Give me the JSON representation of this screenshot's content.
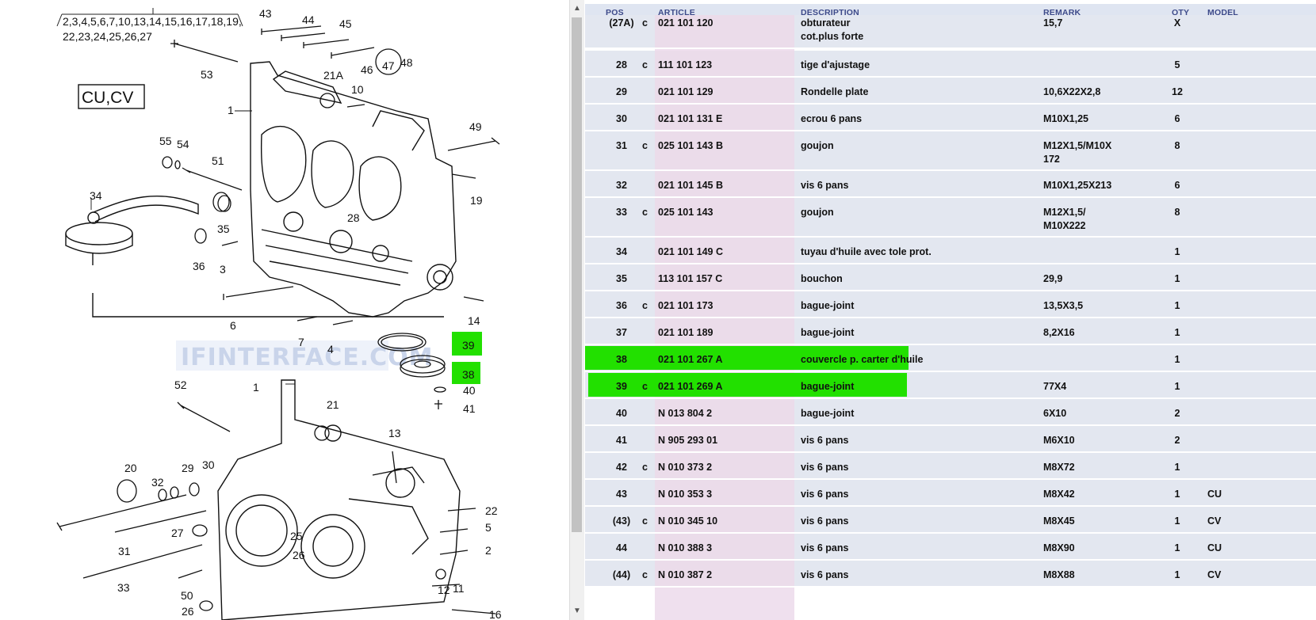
{
  "diagram": {
    "top_list_line1": "2,3,4,5,6,7,10,13,14,15,16,17,18,19,",
    "top_list_line2": "22,23,24,25,26,27",
    "variant_box": "CU,CV",
    "watermark": "IFINTERFACE.COM",
    "callouts": {
      "c43": "43",
      "c44": "44",
      "c45": "45",
      "c46": "46",
      "c47": "47",
      "c48": "48",
      "c53": "53",
      "c21A": "21A",
      "c10": "10",
      "c1a": "1",
      "c49": "49",
      "c55": "55",
      "c54": "54",
      "c51": "51",
      "c34": "34",
      "c19": "19",
      "c35": "35",
      "c28": "28",
      "c36": "36",
      "c3a": "3",
      "c6": "6",
      "c7": "7",
      "c4": "4",
      "c14": "14",
      "c39": "39",
      "c38": "38",
      "c40": "40",
      "c41": "41",
      "c52": "52",
      "c1b": "1",
      "c21": "21",
      "c13": "13",
      "c20": "20",
      "c29": "29",
      "c30": "30",
      "c32": "32",
      "c22": "22",
      "c5": "5",
      "c27": "27",
      "c25": "25",
      "c31": "31",
      "c26a": "26",
      "c2": "2",
      "c33": "33",
      "c50": "50",
      "c12": "12",
      "c11": "11",
      "c26b": "26",
      "c16": "16"
    },
    "highlight_color": "#22e000"
  },
  "table": {
    "headers": {
      "pos": "POS",
      "article": "ARTICLE",
      "description": "DESCRIPTION",
      "remark": "REMARK",
      "qty": "QTY",
      "model": "MODEL"
    },
    "rows": [
      {
        "pos": "(27A)",
        "flag": "c",
        "article": "021 101 120",
        "description": "obturateur\ncot.plus forte",
        "remark": "15,7",
        "qty": "X",
        "model": ""
      },
      {
        "pos": "28",
        "flag": "c",
        "article": "111 101 123",
        "description": "tige d'ajustage",
        "remark": "",
        "qty": "5",
        "model": ""
      },
      {
        "pos": "29",
        "flag": "",
        "article": "021 101 129",
        "description": "Rondelle plate",
        "remark": "10,6X22X2,8",
        "qty": "12",
        "model": ""
      },
      {
        "pos": "30",
        "flag": "",
        "article": "021 101 131 E",
        "description": "ecrou 6 pans",
        "remark": "M10X1,25",
        "qty": "6",
        "model": ""
      },
      {
        "pos": "31",
        "flag": "c",
        "article": "025 101 143 B",
        "description": "goujon",
        "remark": "M12X1,5/M10X\n172",
        "qty": "8",
        "model": ""
      },
      {
        "pos": "32",
        "flag": "",
        "article": "021 101 145 B",
        "description": "vis 6 pans",
        "remark": "M10X1,25X213",
        "qty": "6",
        "model": ""
      },
      {
        "pos": "33",
        "flag": "c",
        "article": "025 101 143",
        "description": "goujon",
        "remark": "M12X1,5/\nM10X222",
        "qty": "8",
        "model": ""
      },
      {
        "pos": "34",
        "flag": "",
        "article": "021 101 149 C",
        "description": "tuyau d'huile avec tole prot.",
        "remark": "",
        "qty": "1",
        "model": ""
      },
      {
        "pos": "35",
        "flag": "",
        "article": "113 101 157 C",
        "description": "bouchon",
        "remark": "29,9",
        "qty": "1",
        "model": ""
      },
      {
        "pos": "36",
        "flag": "c",
        "article": "021 101 173",
        "description": "bague-joint",
        "remark": "13,5X3,5",
        "qty": "1",
        "model": ""
      },
      {
        "pos": "37",
        "flag": "",
        "article": "021 101 189",
        "description": "bague-joint",
        "remark": "8,2X16",
        "qty": "1",
        "model": ""
      },
      {
        "pos": "38",
        "flag": "",
        "article": "021 101 267 A",
        "description": "couvercle p. carter d'huile",
        "remark": "",
        "qty": "1",
        "model": ""
      },
      {
        "pos": "39",
        "flag": "c",
        "article": "021 101 269 A",
        "description": "bague-joint",
        "remark": "77X4",
        "qty": "1",
        "model": ""
      },
      {
        "pos": "40",
        "flag": "",
        "article": "N   013 804 2",
        "description": "bague-joint",
        "remark": "6X10",
        "qty": "2",
        "model": ""
      },
      {
        "pos": "41",
        "flag": "",
        "article": "N   905 293 01",
        "description": "vis 6 pans",
        "remark": "M6X10",
        "qty": "2",
        "model": ""
      },
      {
        "pos": "42",
        "flag": "c",
        "article": "N   010 373 2",
        "description": "vis 6 pans",
        "remark": "M8X72",
        "qty": "1",
        "model": ""
      },
      {
        "pos": "43",
        "flag": "",
        "article": "N   010 353 3",
        "description": "vis 6 pans",
        "remark": "M8X42",
        "qty": "1",
        "model": "CU"
      },
      {
        "pos": "(43)",
        "flag": "c",
        "article": "N   010 345 10",
        "description": "vis 6 pans",
        "remark": "M8X45",
        "qty": "1",
        "model": "CV"
      },
      {
        "pos": "44",
        "flag": "",
        "article": "N   010 388 3",
        "description": "vis 6 pans",
        "remark": "M8X90",
        "qty": "1",
        "model": "CU"
      },
      {
        "pos": "(44)",
        "flag": "c",
        "article": "N   010 387 2",
        "description": "vis 6 pans",
        "remark": "M8X88",
        "qty": "1",
        "model": "CV"
      }
    ]
  },
  "colors": {
    "header_bg": "#dfe5f1",
    "header_text": "#3d4a8a",
    "row_bg": "#e3e7f0",
    "article_band": "#ebdcea",
    "highlight": "#22e000"
  },
  "scrollbar": {
    "up_icon": "▲",
    "down_icon": "▼"
  }
}
